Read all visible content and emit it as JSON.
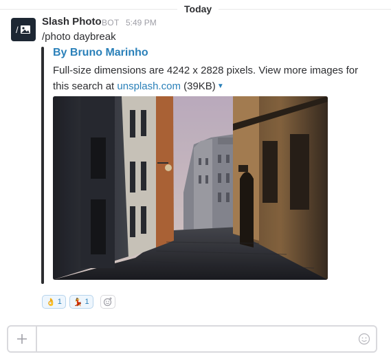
{
  "day_divider": "Today",
  "message": {
    "sender": "Slash Photo",
    "bot_label": "BOT",
    "time": "5:49 PM",
    "command": "/photo daybreak",
    "avatar_icon": "image-icon"
  },
  "attachment": {
    "title": "By Bruno Marinho",
    "text_prefix": "Full-size dimensions are 4242 x 2828 pixels. View more images for this search at ",
    "link_text": "unsplash.com",
    "size_text": " (39KB)",
    "image_alt": "Cobblestone street between old buildings at daybreak"
  },
  "reactions": [
    {
      "emoji": "👌",
      "count": "1"
    },
    {
      "emoji": "💃",
      "count": "1"
    }
  ],
  "composer": {
    "placeholder": ""
  },
  "colors": {
    "link": "#2a80b9",
    "text": "#2c2d30",
    "muted": "#9e9ea6",
    "avatar_bg": "#1d2733"
  }
}
